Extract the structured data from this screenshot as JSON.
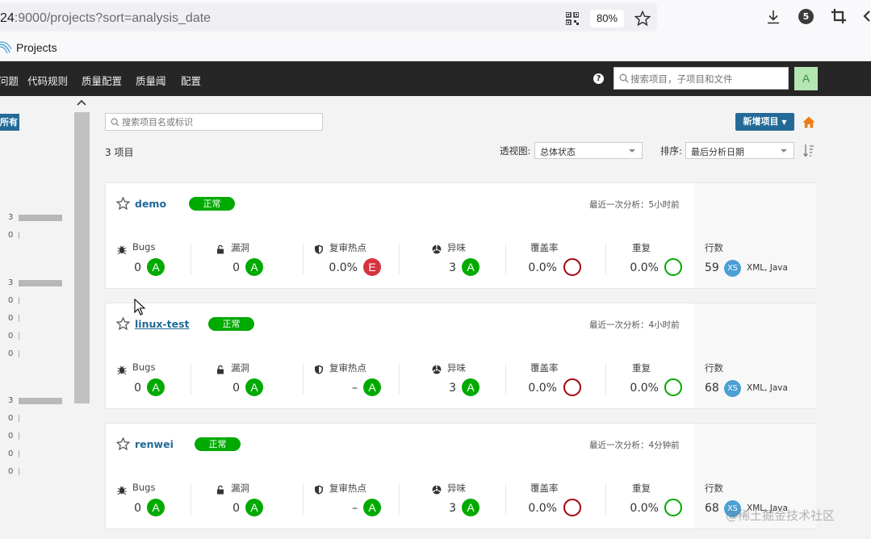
{
  "browser": {
    "url_host": "24",
    "url_rest": ":9000/projects?sort=analysis_date",
    "zoom": "80%",
    "badge_count": "5",
    "bookmark": "Projects"
  },
  "nav": {
    "items": [
      "问题",
      "代码规则",
      "质量配置",
      "质量阈",
      "配置"
    ],
    "help": "?",
    "search_placeholder": "搜索项目，子项目和文件",
    "avatar": "A"
  },
  "sidebar": {
    "button": "所有",
    "facets": [
      {
        "value": "3",
        "fill": 1.0
      },
      {
        "value": "0",
        "fill": 0
      },
      {
        "value": "3",
        "fill": 1.0
      },
      {
        "value": "0",
        "fill": 0
      },
      {
        "value": "0",
        "fill": 0
      },
      {
        "value": "0",
        "fill": 0
      },
      {
        "value": "0",
        "fill": 0
      },
      {
        "value": "3",
        "fill": 1.0
      },
      {
        "value": "0",
        "fill": 0
      },
      {
        "value": "0",
        "fill": 0
      },
      {
        "value": "0",
        "fill": 0
      },
      {
        "value": "0",
        "fill": 0
      }
    ]
  },
  "toolbar": {
    "search_placeholder": "搜索项目名或标识",
    "new_project": "新增项目",
    "count": "3 项目",
    "perspective_label": "透视图:",
    "perspective_value": "总体状态",
    "sort_label": "排序:",
    "sort_value": "最后分析日期"
  },
  "metric_labels": {
    "bugs": "Bugs",
    "vulns": "漏洞",
    "hotspots": "复审热点",
    "smells": "异味",
    "coverage": "覆盖率",
    "duplication": "重复",
    "lines": "行数"
  },
  "projects": [
    {
      "name": "demo",
      "status": "正常",
      "analyzed": "最近一次分析：5小时前",
      "bugs": "0",
      "bugs_rating": "A",
      "vulns": "0",
      "vulns_rating": "A",
      "hotspots": "0.0%",
      "hotspots_rating": "E",
      "smells": "3",
      "smells_rating": "A",
      "coverage": "0.0%",
      "duplication": "0.0%",
      "lines": "59",
      "size": "XS",
      "languages": "XML, Java"
    },
    {
      "name": "linux-test",
      "status": "正常",
      "analyzed": "最近一次分析：4小时前",
      "bugs": "0",
      "bugs_rating": "A",
      "vulns": "0",
      "vulns_rating": "A",
      "hotspots": "–",
      "hotspots_rating": "A",
      "smells": "3",
      "smells_rating": "A",
      "coverage": "0.0%",
      "duplication": "0.0%",
      "lines": "68",
      "size": "XS",
      "languages": "XML, Java"
    },
    {
      "name": "renwei",
      "status": "正常",
      "analyzed": "最近一次分析：4分钟前",
      "bugs": "0",
      "bugs_rating": "A",
      "vulns": "0",
      "vulns_rating": "A",
      "hotspots": "–",
      "hotspots_rating": "A",
      "smells": "3",
      "smells_rating": "A",
      "coverage": "0.0%",
      "duplication": "0.0%",
      "lines": "68",
      "size": "XS",
      "languages": "XML, Java"
    }
  ],
  "watermark": "@稀土掘金技术社区"
}
